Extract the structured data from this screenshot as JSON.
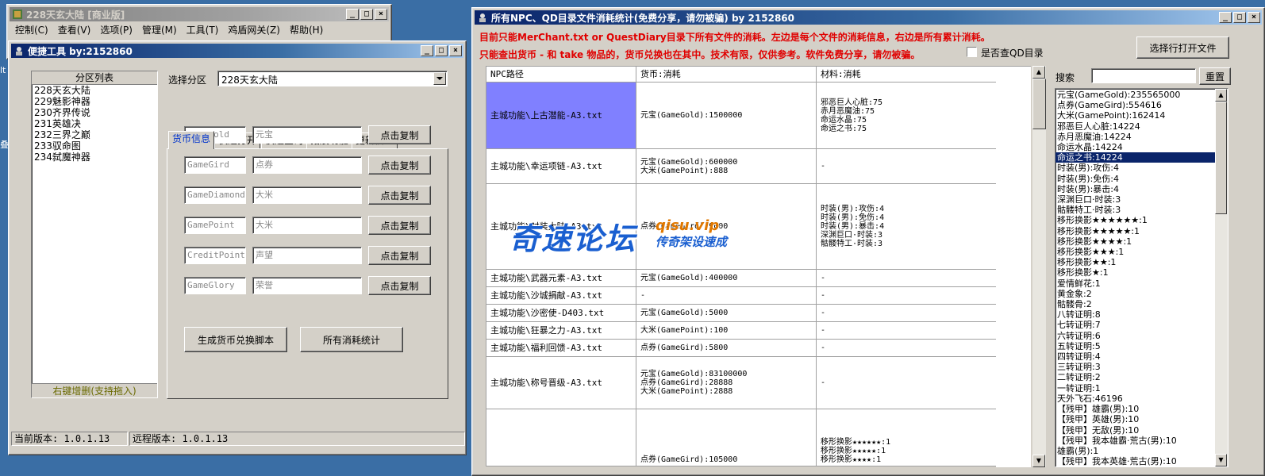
{
  "desktop": {
    "edge_label_1": "lt",
    "edge_label_2": "叠"
  },
  "bg_window": {
    "title": "228天玄大陆 [商业版]",
    "menu": [
      "控制(C)",
      "查看(V)",
      "选项(P)",
      "管理(M)",
      "工具(T)",
      "鸡盾网关(Z)",
      "帮助(H)"
    ]
  },
  "tool_window": {
    "title": "便捷工具    by:2152860",
    "list_header": "分区列表",
    "list_items": [
      "228天玄大陆",
      "229魅影神器",
      "230齐界传说",
      "231英雄决",
      "232三界之巅",
      "233驭命图",
      "234弑魔神器"
    ],
    "list_footer": "右键增删(支持拖入)",
    "select_label": "选择分区",
    "select_value": "228天玄大陆",
    "tabs": [
      "货币信息",
      "快速打开",
      "快速查询",
      "拓展功能",
      "更新信息"
    ],
    "currency_rows": [
      {
        "code": "GameGold",
        "name": "元宝",
        "button": "点击复制"
      },
      {
        "code": "GameGird",
        "name": "点券",
        "button": "点击复制"
      },
      {
        "code": "GameDiamond",
        "name": "大米",
        "button": "点击复制"
      },
      {
        "code": "GamePoint",
        "name": "大米",
        "button": "点击复制"
      },
      {
        "code": "CreditPoint",
        "name": "声望",
        "button": "点击复制"
      },
      {
        "code": "GameGlory",
        "name": "荣誉",
        "button": "点击复制"
      }
    ],
    "gen_button": "生成货币兑换脚本",
    "stats_button": "所有消耗统计",
    "status_current": "当前版本: 1.0.1.13",
    "status_remote": "远程版本: 1.0.1.13"
  },
  "stats_window": {
    "title": "所有NPC、QD目录文件消耗统计(免费分享，请勿被骗)       by 2152860",
    "note1": "目前只能MerChant.txt or QuestDiary目录下所有文件的消耗。左边是每个文件的消耗信息，右边是所有累计消耗。",
    "note2": "只能查出货币 - 和 take 物品的，货币兑换也在其中。技术有限，仅供参考。软件免费分享，请勿被骗。",
    "checkbox_label": "是否查QD目录",
    "open_button": "选择行打开文件",
    "search_label": "搜索",
    "reset_button": "重置",
    "columns": [
      "NPC路径",
      "货币:消耗",
      "材料:消耗"
    ],
    "rows": [
      {
        "path": "主城功能\\上古潜能-A3.txt",
        "currency": [
          "元宝(GameGold):1500000"
        ],
        "materials": [
          "邪恶巨人心脏:75",
          "赤月恶魔油:75",
          "命运水晶:75",
          "命运之书:75"
        ]
      },
      {
        "path": "主城功能\\幸运项链-A3.txt",
        "currency": [
          "元宝(GameGold):600000",
          "大米(GamePoint):888"
        ],
        "materials": [
          "-"
        ]
      },
      {
        "path": "主城功能\\时装大陆-A3.txt",
        "currency": [
          "点券(GameGird):9000"
        ],
        "materials": [
          "时装(男):攻伤:4",
          "时装(男):免伤:4",
          "时装(男):暴击:4",
          "深渊巨口·时装:3",
          "骷髅特工·时装:3"
        ]
      },
      {
        "path": "主城功能\\武器元素-A3.txt",
        "currency": [
          "元宝(GameGold):400000"
        ],
        "materials": [
          "-"
        ]
      },
      {
        "path": "主城功能\\沙城捐献-A3.txt",
        "currency": [
          "-"
        ],
        "materials": [
          "-"
        ]
      },
      {
        "path": "主城功能\\沙密使-D403.txt",
        "currency": [
          "元宝(GameGold):5000"
        ],
        "materials": [
          "-"
        ]
      },
      {
        "path": "主城功能\\狂暴之力-A3.txt",
        "currency": [
          "大米(GamePoint):100"
        ],
        "materials": [
          "-"
        ]
      },
      {
        "path": "主城功能\\福利回馈-A3.txt",
        "currency": [
          "点券(GameGird):5800"
        ],
        "materials": [
          "-"
        ]
      },
      {
        "path": "主城功能\\称号晋级-A3.txt",
        "currency": [
          "元宝(GameGold):83100000",
          "点券(GameGird):28888",
          "大米(GamePoint):2888"
        ],
        "materials": [
          "-"
        ]
      },
      {
        "path": "",
        "currency": [
          "点券(GameGird):105000"
        ],
        "materials": [
          "移形换影★★★★★★:1",
          "移形换影★★★★★:1",
          "移形换影★★★★:1"
        ]
      }
    ],
    "totals": [
      "元宝(GameGold):235565000",
      "点券(GameGird):554616",
      "大米(GamePoint):162414",
      "邪恶巨人心脏:14224",
      "赤月恶魔油:14224",
      "命运水晶:14224",
      "命运之书:14224",
      "时装(男):攻伤:4",
      "时装(男):免伤:4",
      "时装(男):暴击:4",
      "深渊巨口·时装:3",
      "骷髅特工·时装:3",
      "移形换影★★★★★★:1",
      "移形换影★★★★★:1",
      "移形换影★★★★:1",
      "移形换影★★★:1",
      "移形换影★★:1",
      "移形换影★:1",
      "爱情鲜花:1",
      "黄金象:2",
      "骷髅骨:2",
      "八转证明:8",
      "七转证明:7",
      "六转证明:6",
      "五转证明:5",
      "四转证明:4",
      "三转证明:3",
      "二转证明:2",
      "一转证明:1",
      "天外飞石:46196",
      "【残甲】雄霸(男):10",
      "【残甲】英雄(男):10",
      "【残甲】无敌(男):10",
      "【残甲】我本雄霸·荒古(男):10",
      "雄霸(男):1",
      "【残甲】我本英雄·荒古(男):10"
    ],
    "selected_total_index": 6
  },
  "watermark": {
    "main": "奇速论坛",
    "url": "qisu.vip",
    "sub": "传奇架设速成"
  },
  "colors": {
    "title_active": "#0a246a",
    "highlight_cell": "#8080ff",
    "note_red": "#e00000",
    "tab_blue": "#0033cc"
  }
}
